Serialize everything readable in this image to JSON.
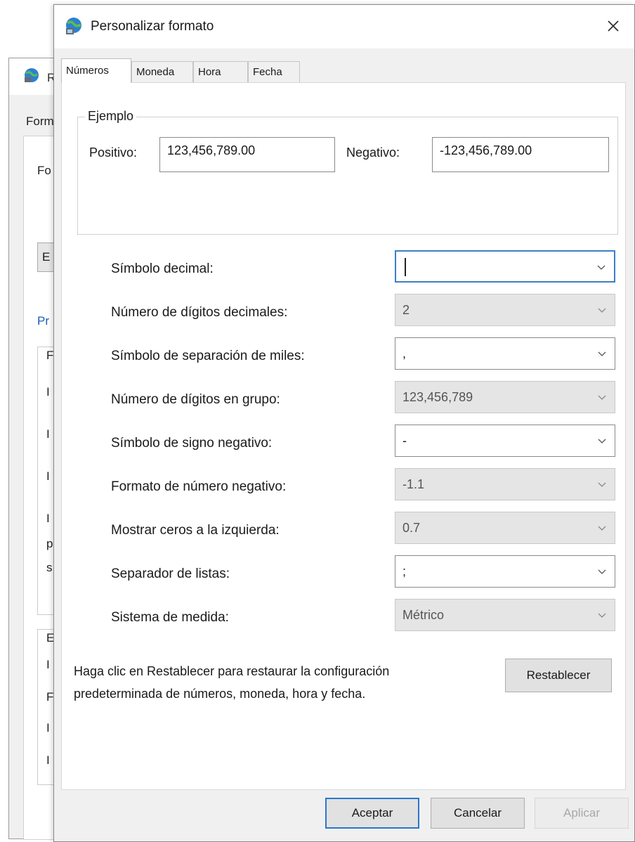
{
  "background_window": {
    "title": "R",
    "tab": "Form",
    "label_1": "Fo",
    "combo_value": "E",
    "link": "Pr",
    "group_1_marks": [
      "F",
      "I",
      "I",
      "I",
      "I",
      "p",
      "s"
    ],
    "group_2_marks": [
      "E",
      "I",
      "F",
      "I",
      "I"
    ]
  },
  "dialog": {
    "title": "Personalizar formato",
    "tabs": [
      "Números",
      "Moneda",
      "Hora",
      "Fecha"
    ],
    "example": {
      "legend": "Ejemplo",
      "positive_label": "Positivo:",
      "positive_value": "123,456,789.00",
      "negative_label": "Negativo:",
      "negative_value": "-123,456,789.00"
    },
    "settings": [
      {
        "label": "Símbolo decimal:",
        "value": ""
      },
      {
        "label": "Número de dígitos decimales:",
        "value": "2"
      },
      {
        "label": "Símbolo de separación de miles:",
        "value": ","
      },
      {
        "label": "Número de dígitos en grupo:",
        "value": "123,456,789"
      },
      {
        "label": "Símbolo de signo negativo:",
        "value": "-"
      },
      {
        "label": "Formato de número negativo:",
        "value": "-1.1"
      },
      {
        "label": "Mostrar ceros a la izquierda:",
        "value": "0.7"
      },
      {
        "label": "Separador de listas:",
        "value": ";"
      },
      {
        "label": "Sistema de medida:",
        "value": "Métrico"
      }
    ],
    "footer_text_line1": "Haga clic en Restablecer para restaurar la configuración",
    "footer_text_line2": "predeterminada de números, moneda, hora y fecha.",
    "reset_label": "Restablecer",
    "ok_label": "Aceptar",
    "cancel_label": "Cancelar",
    "apply_label": "Aplicar"
  },
  "colors": {
    "focus_border": "#3b7fc4",
    "primary_border": "#2a78c9",
    "link": "#1a5fb4"
  },
  "icons": [
    "globe-icon",
    "close-icon",
    "chevron-down-icon"
  ]
}
